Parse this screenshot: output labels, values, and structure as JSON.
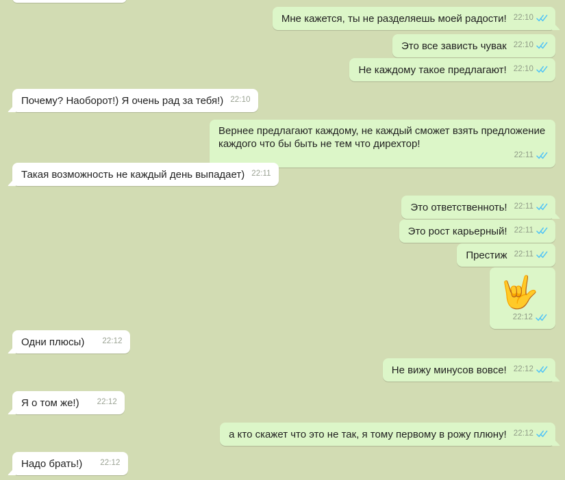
{
  "app": {
    "type": "messaging-chat",
    "background_color": "#d2dcb3",
    "incoming_bubble_color": "#ffffff",
    "outgoing_bubble_color": "#dcf6c8",
    "tick_color": "#4fc3f7",
    "time_color": "#8f9b86"
  },
  "messages": [
    {
      "id": "m0",
      "direction": "in",
      "text": "",
      "time": "",
      "partial": true
    },
    {
      "id": "m1",
      "direction": "out",
      "text": "Мне кажется, ты не разделяешь моей радости!",
      "time": "22:10",
      "status": "read",
      "tail": true
    },
    {
      "id": "m2",
      "direction": "out",
      "text": "Это все зависть чувак",
      "time": "22:10",
      "status": "read",
      "tail": false
    },
    {
      "id": "m3",
      "direction": "out",
      "text": "Не каждому такое предлагают!",
      "time": "22:10",
      "status": "read",
      "tail": false
    },
    {
      "id": "m4",
      "direction": "in",
      "text": "Почему? Наоборот!) Я очень рад за тебя!)",
      "time": "22:10",
      "tail": true
    },
    {
      "id": "m5",
      "direction": "out",
      "text": "Вернее предлагают каждому, не каждый сможет взять предложение каждого что бы быть не тем что дирехтор!",
      "time": "22:11",
      "status": "read",
      "tail": false
    },
    {
      "id": "m6",
      "direction": "in",
      "text": "Такая возможность не каждый день выпадает)",
      "time": "22:11",
      "tail": true
    },
    {
      "id": "m7",
      "direction": "out",
      "text": "Это ответственноть!",
      "time": "22:11",
      "status": "read",
      "tail": true
    },
    {
      "id": "m8",
      "direction": "out",
      "text": "Это рост карьерный!",
      "time": "22:11",
      "status": "read",
      "tail": false
    },
    {
      "id": "m9",
      "direction": "out",
      "text": "Престиж",
      "time": "22:11",
      "status": "read",
      "tail": false
    },
    {
      "id": "m10",
      "direction": "out",
      "emoji": "🤟",
      "emoji_name": "love-you-gesture-emoji",
      "time": "22:12",
      "status": "read",
      "tail": false
    },
    {
      "id": "m11",
      "direction": "in",
      "text": "Одни плюсы)",
      "time": "22:12",
      "tail": true
    },
    {
      "id": "m12",
      "direction": "out",
      "text": "Не вижу минусов вовсе!",
      "time": "22:12",
      "status": "read",
      "tail": true
    },
    {
      "id": "m13",
      "direction": "in",
      "text": "Я о том же!)",
      "time": "22:12",
      "tail": true
    },
    {
      "id": "m14",
      "direction": "out",
      "text": "а кто скажет что это не так, я тому первому в рожу плюну!",
      "time": "22:12",
      "status": "read",
      "tail": true
    },
    {
      "id": "m15",
      "direction": "in",
      "text": "Надо брать!)",
      "time": "22:12",
      "tail": true
    }
  ]
}
